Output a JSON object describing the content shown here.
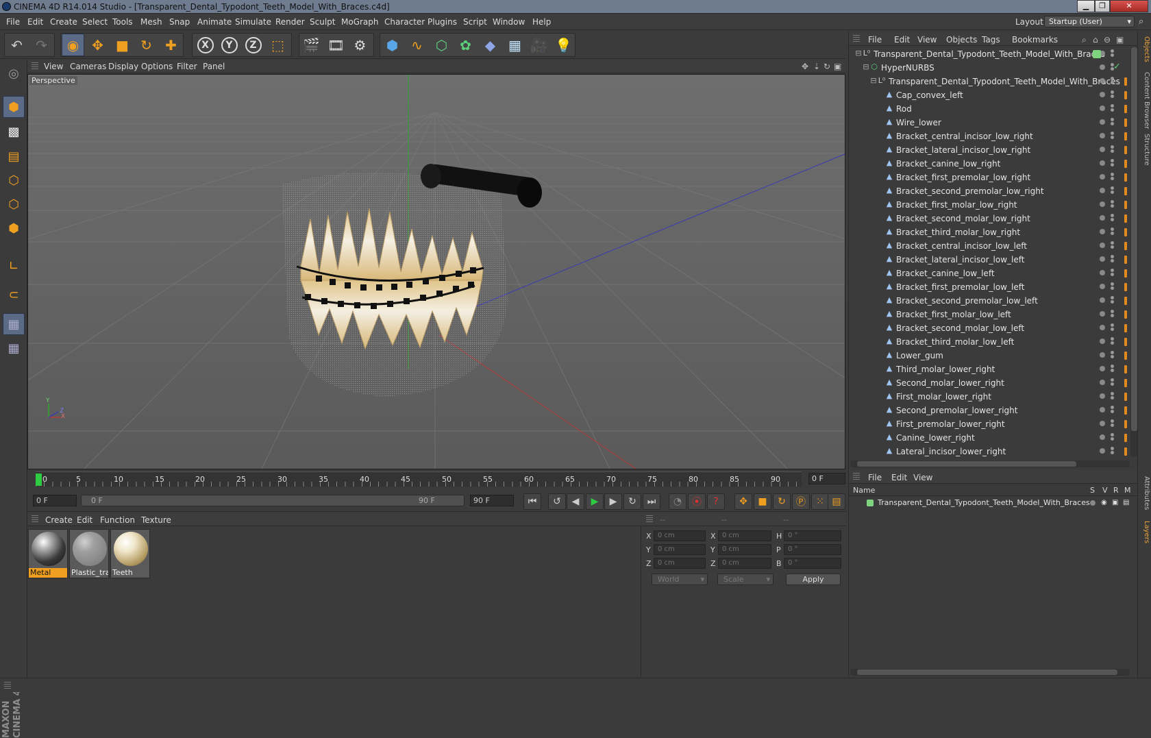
{
  "window": {
    "title": "CINEMA 4D R14.014 Studio - [Transparent_Dental_Typodont_Teeth_Model_With_Braces.c4d]",
    "layout_label": "Layout:",
    "layout_value": "Startup (User)"
  },
  "menubar": [
    "File",
    "Edit",
    "Create",
    "Select",
    "Tools",
    "Mesh",
    "Snap",
    "Animate",
    "Simulate",
    "Render",
    "Sculpt",
    "MoGraph",
    "Character",
    "Plugins",
    "Script",
    "Window",
    "Help"
  ],
  "viewport": {
    "menu": [
      "View",
      "Cameras",
      "Display",
      "Options",
      "Filter",
      "Panel"
    ],
    "label": "Perspective",
    "axis_y": "Y",
    "axis_x": "X",
    "axis_z": "Z"
  },
  "timeline": {
    "ticks": [
      "0",
      "5",
      "10",
      "15",
      "20",
      "25",
      "30",
      "35",
      "40",
      "45",
      "50",
      "55",
      "60",
      "65",
      "70",
      "75",
      "80",
      "85",
      "90"
    ],
    "current_frame": "0 F"
  },
  "playback": {
    "start_field": "0 F",
    "range_start": "0 F",
    "range_end": "90 F",
    "end_field": "90 F"
  },
  "material_panel": {
    "menu": [
      "Create",
      "Edit",
      "Function",
      "Texture"
    ],
    "materials": [
      {
        "name": "Metal",
        "selected": true
      },
      {
        "name": "Plastic_tran",
        "selected": false
      },
      {
        "name": "Teeth",
        "selected": false
      }
    ]
  },
  "coordinates": {
    "headers": [
      "--",
      "--",
      "--"
    ],
    "rows": [
      {
        "a": "X",
        "av": "0 cm",
        "b": "X",
        "bv": "0 cm",
        "c": "H",
        "cv": "0 °"
      },
      {
        "a": "Y",
        "av": "0 cm",
        "b": "Y",
        "bv": "0 cm",
        "c": "P",
        "cv": "0 °"
      },
      {
        "a": "Z",
        "av": "0 cm",
        "b": "Z",
        "bv": "0 cm",
        "c": "B",
        "cv": "0 °"
      }
    ],
    "mode_world": "World",
    "mode_scale": "Scale",
    "apply": "Apply"
  },
  "object_manager": {
    "menu": [
      "File",
      "Edit",
      "View",
      "Objects",
      "Tags",
      "Bookmarks"
    ],
    "objects": [
      {
        "name": "Transparent_Dental_Typodont_Teeth_Model_With_Braces",
        "depth": 0,
        "type": "null"
      },
      {
        "name": "HyperNURBS",
        "depth": 1,
        "type": "nurbs"
      },
      {
        "name": "Transparent_Dental_Typodont_Teeth_Model_With_Braces",
        "depth": 2,
        "type": "null"
      },
      {
        "name": "Cap_convex_left",
        "depth": 3,
        "type": "mesh"
      },
      {
        "name": "Rod",
        "depth": 3,
        "type": "mesh"
      },
      {
        "name": "Wire_lower",
        "depth": 3,
        "type": "mesh"
      },
      {
        "name": "Bracket_central_incisor_low_right",
        "depth": 3,
        "type": "mesh"
      },
      {
        "name": "Bracket_lateral_incisor_low_right",
        "depth": 3,
        "type": "mesh"
      },
      {
        "name": "Bracket_canine_low_right",
        "depth": 3,
        "type": "mesh"
      },
      {
        "name": "Bracket_first_premolar_low_right",
        "depth": 3,
        "type": "mesh"
      },
      {
        "name": "Bracket_second_premolar_low_right",
        "depth": 3,
        "type": "mesh"
      },
      {
        "name": "Bracket_first_molar_low_right",
        "depth": 3,
        "type": "mesh"
      },
      {
        "name": "Bracket_second_molar_low_right",
        "depth": 3,
        "type": "mesh"
      },
      {
        "name": "Bracket_third_molar_low_right",
        "depth": 3,
        "type": "mesh"
      },
      {
        "name": "Bracket_central_incisor_low_left",
        "depth": 3,
        "type": "mesh"
      },
      {
        "name": "Bracket_lateral_incisor_low_left",
        "depth": 3,
        "type": "mesh"
      },
      {
        "name": "Bracket_canine_low_left",
        "depth": 3,
        "type": "mesh"
      },
      {
        "name": "Bracket_first_premolar_low_left",
        "depth": 3,
        "type": "mesh"
      },
      {
        "name": "Bracket_second_premolar_low_left",
        "depth": 3,
        "type": "mesh"
      },
      {
        "name": "Bracket_first_molar_low_left",
        "depth": 3,
        "type": "mesh"
      },
      {
        "name": "Bracket_second_molar_low_left",
        "depth": 3,
        "type": "mesh"
      },
      {
        "name": "Bracket_third_molar_low_left",
        "depth": 3,
        "type": "mesh"
      },
      {
        "name": "Lower_gum",
        "depth": 3,
        "type": "mesh"
      },
      {
        "name": "Third_molar_lower_right",
        "depth": 3,
        "type": "mesh"
      },
      {
        "name": "Second_molar_lower_right",
        "depth": 3,
        "type": "mesh"
      },
      {
        "name": "First_molar_lower_right",
        "depth": 3,
        "type": "mesh"
      },
      {
        "name": "Second_premolar_lower_right",
        "depth": 3,
        "type": "mesh"
      },
      {
        "name": "First_premolar_lower_right",
        "depth": 3,
        "type": "mesh"
      },
      {
        "name": "Canine_lower_right",
        "depth": 3,
        "type": "mesh"
      },
      {
        "name": "Lateral_incisor_lower_right",
        "depth": 3,
        "type": "mesh"
      }
    ]
  },
  "layer_manager": {
    "menu": [
      "File",
      "Edit",
      "View"
    ],
    "header_name": "Name",
    "header_flags": [
      "S",
      "V",
      "R",
      "M"
    ],
    "layer_name": "Transparent_Dental_Typodont_Teeth_Model_With_Braces"
  },
  "side_tabs": [
    "Objects",
    "Content Browser",
    "Structure",
    "Attributes",
    "Layers"
  ],
  "branding": "MAXON CINEMA 4D",
  "colors": {
    "accent": "#f0a020",
    "selection": "#5b6a86",
    "layer_green": "#7ed37e"
  }
}
